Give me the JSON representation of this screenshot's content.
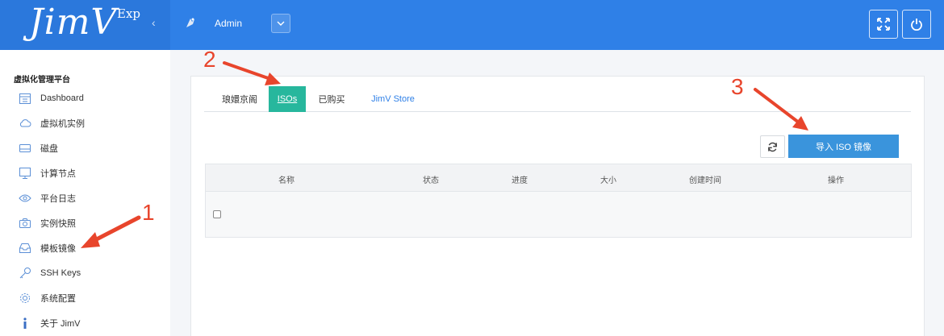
{
  "brand": {
    "logo": "JimV",
    "edition": "Exp"
  },
  "header": {
    "user_name": "Admin"
  },
  "sidebar": {
    "title": "虚拟化管理平台",
    "items": [
      {
        "label": "Dashboard",
        "icon": "calendar-icon"
      },
      {
        "label": "虚拟机实例",
        "icon": "cloud-icon"
      },
      {
        "label": "磁盘",
        "icon": "disk-icon"
      },
      {
        "label": "计算节点",
        "icon": "monitor-icon"
      },
      {
        "label": "平台日志",
        "icon": "eye-icon"
      },
      {
        "label": "实例快照",
        "icon": "camera-icon"
      },
      {
        "label": "模板镜像",
        "icon": "inbox-icon"
      },
      {
        "label": "SSH Keys",
        "icon": "key-icon"
      },
      {
        "label": "系统配置",
        "icon": "gear-icon"
      },
      {
        "label": "关于 JimV",
        "icon": "info-icon"
      }
    ]
  },
  "tabs": [
    {
      "label": "琅嬛京阁"
    },
    {
      "label": "ISOs",
      "active": true
    },
    {
      "label": "已购买"
    },
    {
      "label": "JimV Store"
    }
  ],
  "toolbar": {
    "import_label": "导入 ISO 镜像"
  },
  "table": {
    "columns": [
      "名称",
      "状态",
      "进度",
      "大小",
      "创建时间",
      "操作"
    ]
  },
  "annotations": {
    "n1": "1",
    "n2": "2",
    "n3": "3"
  },
  "colors": {
    "header": "#2f80e7",
    "tab_active": "#27b79d",
    "primary_button": "#3a94dc",
    "annotation": "#e8452c"
  }
}
